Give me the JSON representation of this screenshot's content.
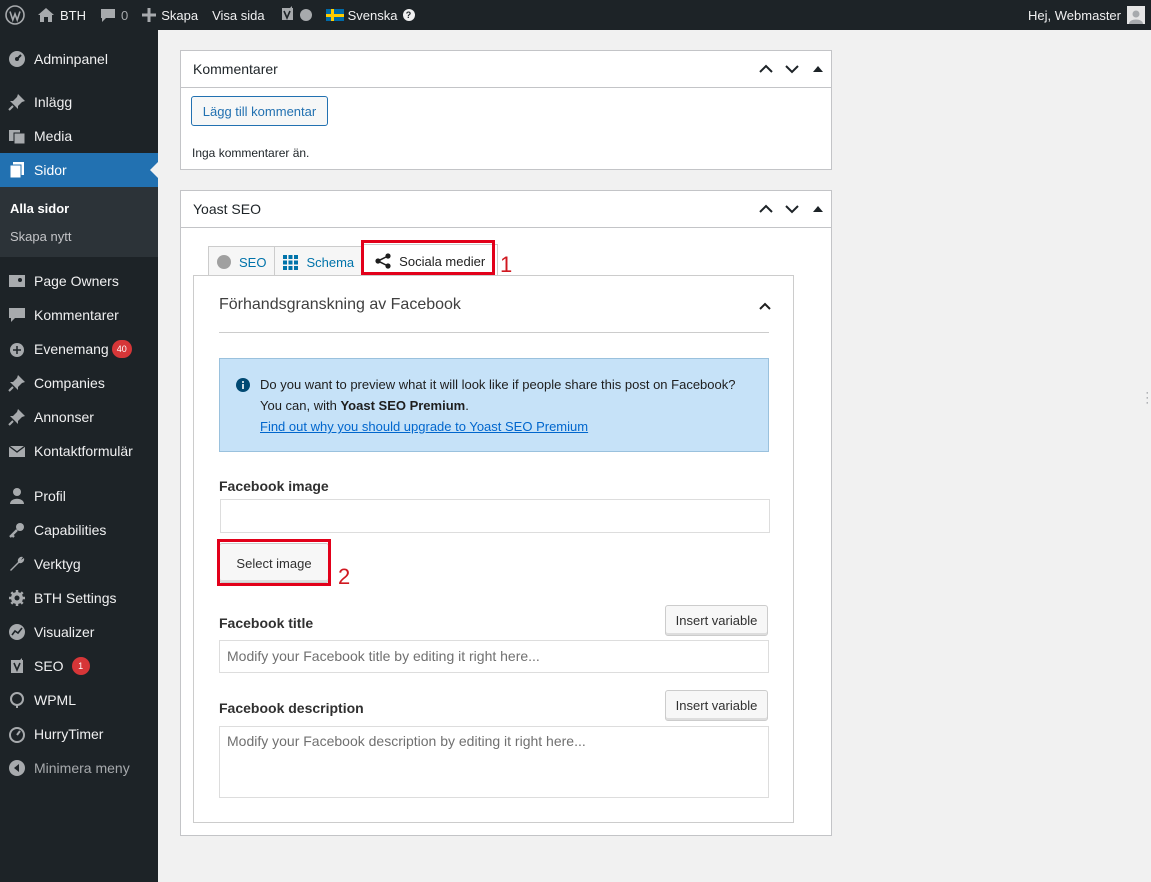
{
  "adminbar": {
    "site_name": "BTH",
    "comments_count": "0",
    "new_label": "Skapa",
    "view_label": "Visa sida",
    "language_label": "Svenska",
    "greeting": "Hej, Webmaster"
  },
  "sidebar": {
    "items": [
      {
        "label": "Adminpanel",
        "icon": "dashboard-icon"
      },
      {
        "label": "Inlägg",
        "icon": "pushpin-icon"
      },
      {
        "label": "Media",
        "icon": "media-icon"
      },
      {
        "label": "Sidor",
        "icon": "pages-icon"
      },
      {
        "label": "Page Owners",
        "icon": "page-owners-icon"
      },
      {
        "label": "Kommentarer",
        "icon": "comment-icon"
      },
      {
        "label": "Evenemang",
        "icon": "calendar-icon",
        "badge": "40"
      },
      {
        "label": "Companies",
        "icon": "pushpin-icon"
      },
      {
        "label": "Annonser",
        "icon": "pushpin-icon"
      },
      {
        "label": "Kontaktformulär",
        "icon": "mail-icon"
      },
      {
        "label": "Profil",
        "icon": "user-icon"
      },
      {
        "label": "Capabilities",
        "icon": "key-icon"
      },
      {
        "label": "Verktyg",
        "icon": "wrench-icon"
      },
      {
        "label": "BTH Settings",
        "icon": "gear-icon"
      },
      {
        "label": "Visualizer",
        "icon": "chart-icon"
      },
      {
        "label": "SEO",
        "icon": "yoast-icon",
        "badge": "1"
      },
      {
        "label": "WPML",
        "icon": "wpml-icon"
      },
      {
        "label": "HurryTimer",
        "icon": "timer-icon"
      },
      {
        "label": "Minimera meny",
        "icon": "collapse-icon"
      }
    ],
    "submenu": {
      "all_pages": "Alla sidor",
      "add_new": "Skapa nytt"
    }
  },
  "comments_box": {
    "title": "Kommentarer",
    "add_button": "Lägg till kommentar",
    "empty_text": "Inga kommentarer än."
  },
  "yoast_box": {
    "title": "Yoast SEO",
    "tabs": [
      {
        "label": "SEO"
      },
      {
        "label": "Schema"
      },
      {
        "label": "Sociala medier"
      }
    ],
    "facebook": {
      "heading": "Förhandsgranskning av Facebook",
      "alert_text": "Do you want to preview what it will look like if people share this post on Facebook? You can, with ",
      "alert_strong": "Yoast SEO Premium",
      "alert_period": ".",
      "alert_link": "Find out why you should upgrade to Yoast SEO Premium",
      "image_label": "Facebook image",
      "image_value": "",
      "select_image": "Select image",
      "title_label": "Facebook title",
      "title_placeholder": "Modify your Facebook title by editing it right here...",
      "insert_variable": "Insert variable",
      "description_label": "Facebook description",
      "description_placeholder": "Modify your Facebook description by editing it right here..."
    }
  },
  "annotations": {
    "step1": "1",
    "step2": "2",
    "color": "#e2001a"
  }
}
